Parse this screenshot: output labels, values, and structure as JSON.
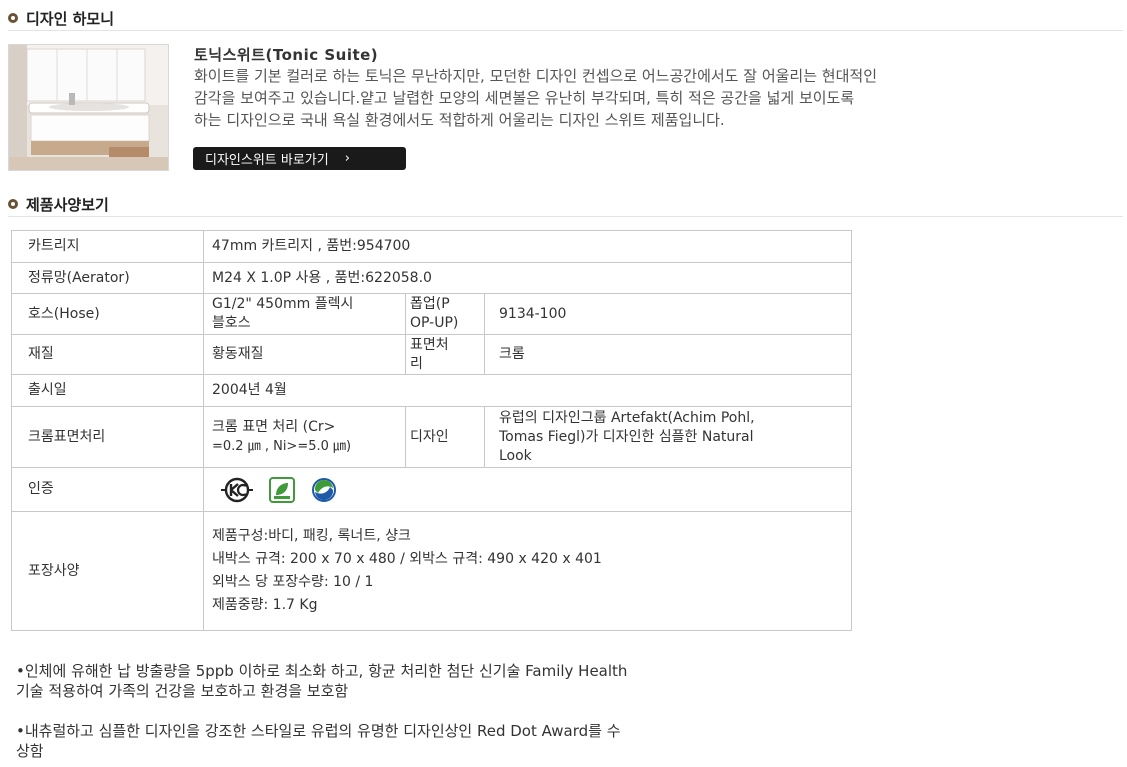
{
  "design_harmony": {
    "section_title": "디자인 하모니",
    "product_title": "토닉스위트(Tonic Suite)",
    "description_lines": [
      "화이트를 기본 컬러로 하는 토닉은 무난하지만, 모던한 디자인 컨셉으로 어느공간에서도 잘 어울리는 현대적인",
      "감각을 보여주고 있습니다.얕고 날렵한 모양의 세면볼은 유난히 부각되며, 특히 적은 공간을 넓게 보이도록",
      "하는 디자인으로 국내 욕실 환경에서도 적합하게 어울리는 디자인 스위트 제품입니다."
    ],
    "button_label": "디자인스위트 바로가기",
    "button_chevron": "›"
  },
  "spec_section": {
    "title": "제품사양보기",
    "cartridge": {
      "label": "카트리지",
      "value": "47mm 카트리지 , 품번:954700"
    },
    "aerator": {
      "label": "정류망(Aerator)",
      "value": "M24 X 1.0P 사용 , 품번:622058.0"
    },
    "hose": {
      "label": "호스(Hose)",
      "value_lines": [
        "G1/2\" 450mm 플렉시",
        "블호스"
      ],
      "sub_label_lines": [
        "폽업(P",
        "OP-UP)"
      ],
      "sub_value": "9134-100"
    },
    "material": {
      "label": "재질",
      "value": "황동재질",
      "sub_label_lines": [
        "표면처",
        "리"
      ],
      "sub_value": "크롬"
    },
    "release": {
      "label": "출시일",
      "value": "2004년 4월"
    },
    "chrome": {
      "label": "크롬표면처리",
      "value_lines": [
        "크롬 표면 처리 (Cr>",
        "=0.2 ㎛ , Ni>=5.0 ㎛)"
      ],
      "sub_label": "디자인",
      "sub_value_lines": [
        "유럽의 디자인그룹 Artefakt(Achim Pohl,",
        "Tomas Fiegl)가 디자인한 심플한 Natural",
        "Look"
      ]
    },
    "certification": {
      "label": "인증",
      "icons": [
        "kc-mark-icon",
        "environment-mark-icon",
        "korea-mark-icon"
      ],
      "colors": {
        "green": "#3f9a3a",
        "blue": "#1e5aa8"
      }
    },
    "packaging": {
      "label": "포장사양",
      "lines": [
        "제품구성:바디, 패킹, 록너트, 샹크",
        "내박스 규격: 200 x 70 x 480 / 외박스 규격: 490 x 420 x 401",
        "외박스 당 포장수량: 10 / 1",
        "제품중량: 1.7 Kg"
      ]
    }
  },
  "notes": [
    {
      "lines": [
        "•인체에 유해한 납 방출량을 5ppb 이하로 최소화 하고, 항균 처리한 첨단 신기술 Family Health",
        "기술 적용하여 가족의 건강을 보호하고 환경을 보호함"
      ]
    },
    {
      "lines": [
        "•내츄럴하고 심플한 디자인을 강조한 스타일로 유럽의 유명한 디자인상인 Red Dot Award를 수",
        "상함"
      ]
    }
  ],
  "colors": {
    "bullet": "#6b5236",
    "button_bg": "#1a1a1a",
    "border": "#c8c8c8"
  }
}
